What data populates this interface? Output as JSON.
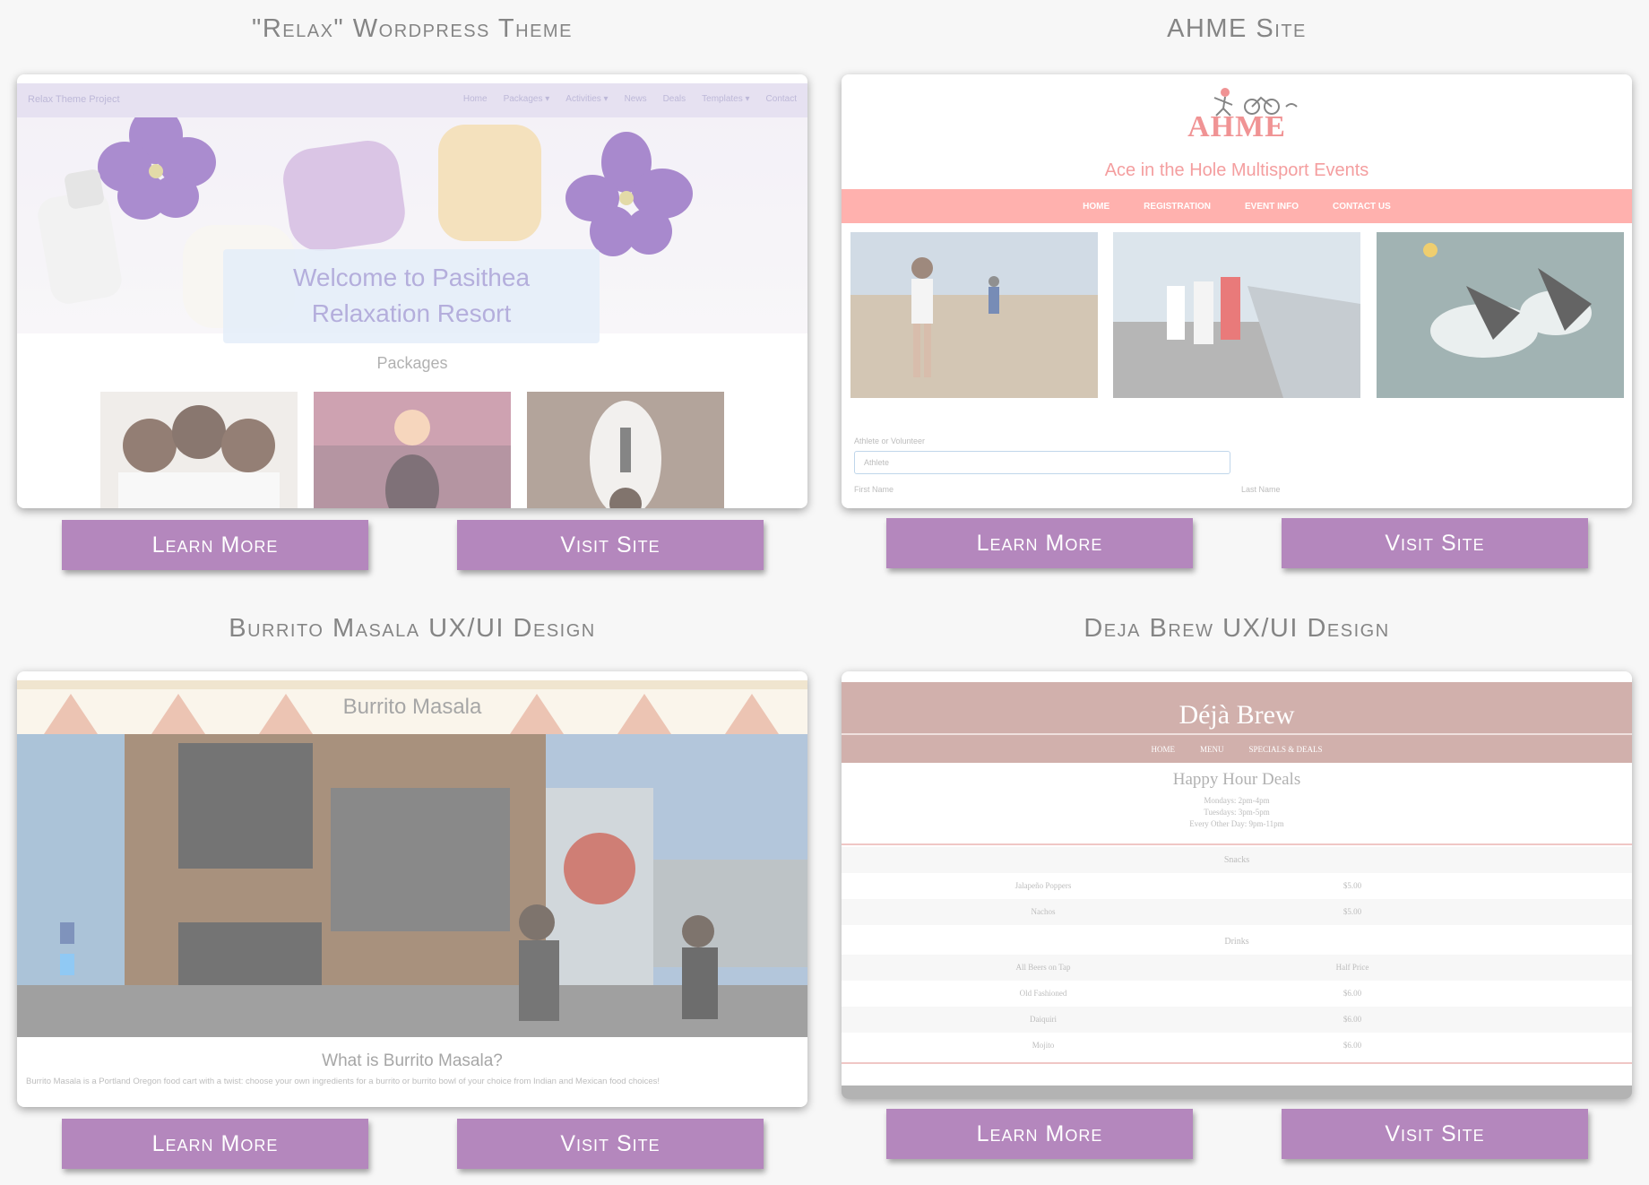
{
  "buttons": {
    "learn_more": "Learn More",
    "visit_site": "Visit Site"
  },
  "colors": {
    "button": "#b487bd",
    "background": "#f7f7f7",
    "title": "#858585"
  },
  "relax": {
    "title": "\"Relax\" Wordpress Theme",
    "brand": "Relax Theme Project",
    "nav": [
      "Home",
      "Packages ▾",
      "Activities ▾",
      "News",
      "Deals",
      "Templates ▾",
      "Contact"
    ],
    "welcome_line1": "Welcome to Pasithea",
    "welcome_line2": "Relaxation Resort",
    "packages": "Packages"
  },
  "ahme": {
    "title": "AHME Site",
    "logo": "AHME",
    "subtitle": "Ace in the Hole Multisport Events",
    "nav": [
      "HOME",
      "REGISTRATION",
      "EVENT INFO",
      "CONTACT US"
    ],
    "field_label": "Athlete or Volunteer",
    "select_value": "Athlete",
    "first_name": "First Name",
    "last_name": "Last Name"
  },
  "burrito": {
    "title": "Burrito Masala UX/UI Design",
    "banner_title": "Burrito Masala",
    "question": "What is Burrito Masala?",
    "description": "Burrito Masala is a Portland Oregon food cart with a twist: choose your own ingredients for a burrito or burrito bowl of your choice from Indian and Mexican food choices!"
  },
  "deja": {
    "title": "Deja Brew UX/UI Design",
    "logo": "Déjà Brew",
    "nav": [
      "HOME",
      "MENU",
      "SPECIALS & DEALS"
    ],
    "happy_hour": "Happy Hour Deals",
    "hours": [
      "Mondays: 2pm-4pm",
      "Tuesdays: 3pm-5pm",
      "Every Other Day: 9pm-11pm"
    ],
    "snacks_label": "Snacks",
    "snacks": [
      {
        "item": "Jalapeño Poppers",
        "price": "$5.00"
      },
      {
        "item": "Nachos",
        "price": "$5.00"
      }
    ],
    "drinks_label": "Drinks",
    "drinks": [
      {
        "item": "All Beers on Tap",
        "price": "Half Price"
      },
      {
        "item": "Old Fashioned",
        "price": "$6.00"
      },
      {
        "item": "Daiquiri",
        "price": "$6.00"
      },
      {
        "item": "Mojito",
        "price": "$6.00"
      }
    ]
  }
}
